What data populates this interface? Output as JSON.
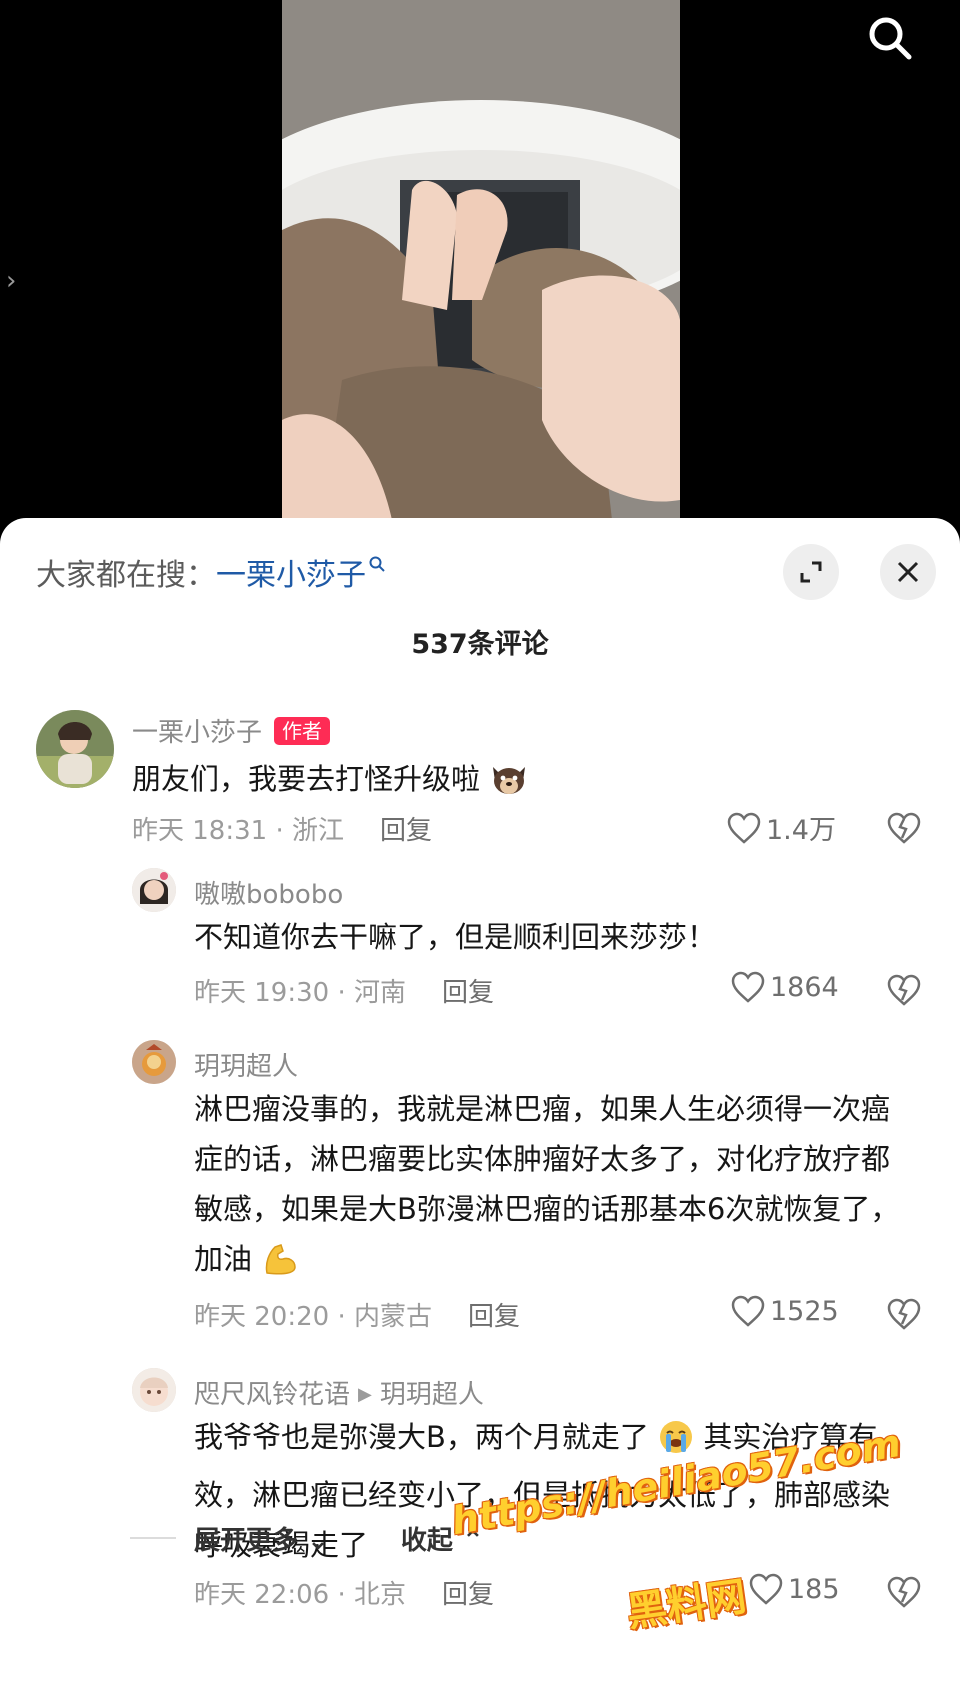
{
  "video": {
    "search_icon": "search-icon"
  },
  "sheet": {
    "search_prefix": "大家都在搜：",
    "search_keyword": "一栗小莎子",
    "comment_count_title": "537条评论"
  },
  "comments": [
    {
      "username": "一栗小莎子",
      "badge": "作者",
      "content": "朋友们，我要去打怪升级啦",
      "time_location": "昨天 18:31 · 浙江",
      "reply_label": "回复",
      "likes": "1.4万"
    },
    {
      "username": "嗷嗷bobobo",
      "content": "不知道你去干嘛了，但是顺利回来莎莎！",
      "time_location": "昨天 19:30 · 河南",
      "reply_label": "回复",
      "likes": "1864"
    },
    {
      "username": "玥玥超人",
      "content": "淋巴瘤没事的，我就是淋巴瘤，如果人生必须得一次癌症的话，淋巴瘤要比实体肿瘤好太多了，对化疗放疗都敏感，如果是大B弥漫淋巴瘤的话那基本6次就恢复了，加油",
      "time_location": "昨天 20:20 · 内蒙古",
      "reply_label": "回复",
      "likes": "1525"
    },
    {
      "username": "咫尺风铃花语",
      "reply_to": "玥玥超人",
      "content_a": "我爷爷也是弥漫大B，两个月就走了",
      "content_b": "其实治疗算有效，淋巴瘤已经变小了，但是抵抗力太低了，肺部感染呼吸衰竭走了",
      "time_location": "昨天 22:06 · 北京",
      "reply_label": "回复",
      "likes": "185"
    }
  ],
  "footer": {
    "expand_more": "展开更多",
    "collapse": "收起"
  },
  "watermark": {
    "url": "https://heiliao57.com",
    "name": "黑料网"
  },
  "colors": {
    "accent_red": "#fe2c55",
    "keyword_blue": "#1f5aa6",
    "watermark_yellow": "#ffcf2e"
  }
}
